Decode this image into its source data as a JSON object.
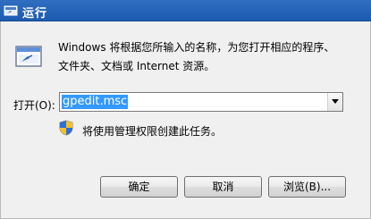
{
  "window": {
    "title": "运行"
  },
  "description": {
    "line1": "Windows 将根据您所输入的名称，为您打开相应的程序、",
    "line2": "文件夹、文档或 Internet 资源。"
  },
  "open_field": {
    "label": "打开(O):",
    "value": "gpedit.msc"
  },
  "admin_note": "将使用管理权限创建此任务。",
  "buttons": {
    "ok": "确定",
    "cancel": "取消",
    "browse": "浏览(B)..."
  },
  "icons": {
    "title": "run-icon",
    "main": "run-window-icon",
    "shield": "uac-shield-icon",
    "dropdown": "chevron-down-icon"
  },
  "colors": {
    "titlebar": "#1d5bb0",
    "selection": "#3399ff"
  }
}
